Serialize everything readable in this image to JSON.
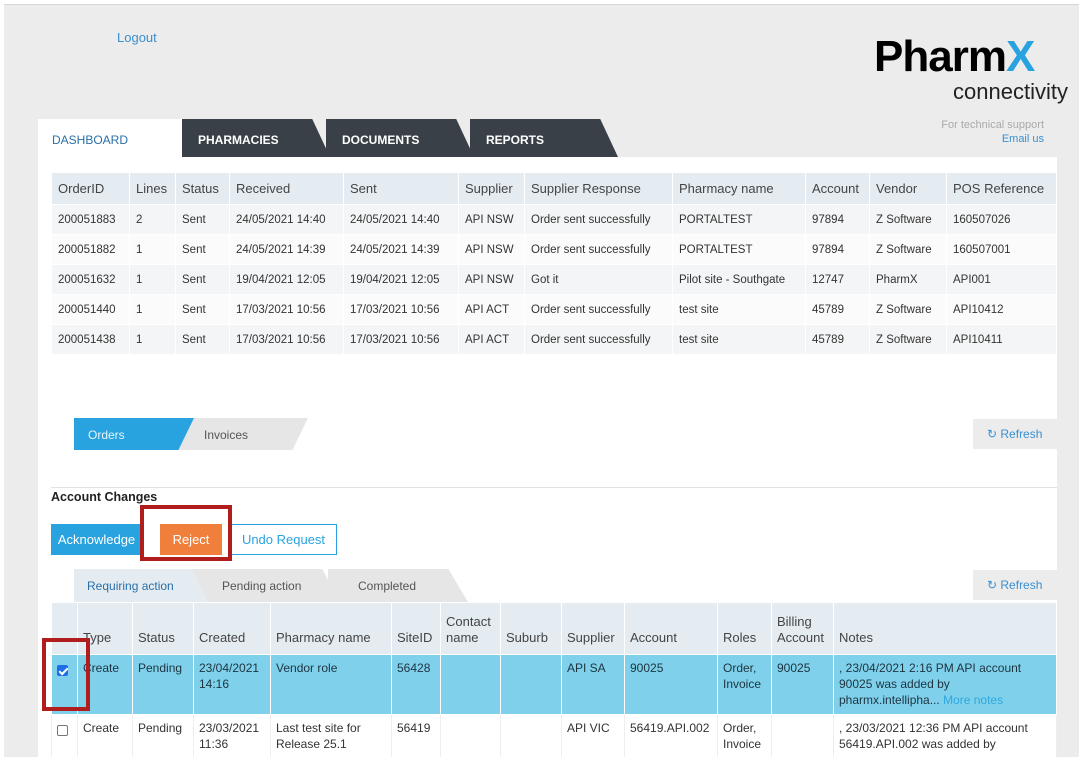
{
  "header": {
    "logout": "Logout",
    "logo_text_a": "Pharm",
    "logo_text_b": "X",
    "logo_sub": "connectivity",
    "support_text": "For technical support",
    "support_link": "Email us"
  },
  "nav": {
    "tabs": [
      "DASHBOARD",
      "PHARMACIES",
      "DOCUMENTS",
      "REPORTS"
    ]
  },
  "orders": {
    "columns": [
      "OrderID",
      "Lines",
      "Status",
      "Received",
      "Sent",
      "Supplier",
      "Supplier Response",
      "Pharmacy name",
      "Account",
      "Vendor",
      "POS Reference"
    ],
    "rows": [
      [
        "200051883",
        "2",
        "Sent",
        "24/05/2021 14:40",
        "24/05/2021 14:40",
        "API NSW",
        "Order sent successfully",
        "PORTALTEST",
        "97894",
        "Z Software",
        "160507026"
      ],
      [
        "200051882",
        "1",
        "Sent",
        "24/05/2021 14:39",
        "24/05/2021 14:39",
        "API NSW",
        "Order sent successfully",
        "PORTALTEST",
        "97894",
        "Z Software",
        "160507001"
      ],
      [
        "200051632",
        "1",
        "Sent",
        "19/04/2021 12:05",
        "19/04/2021 12:05",
        "API NSW",
        "Got it",
        "Pilot site - Southgate",
        "12747",
        "PharmX",
        "API001"
      ],
      [
        "200051440",
        "1",
        "Sent",
        "17/03/2021 10:56",
        "17/03/2021 10:56",
        "API ACT",
        "Order sent successfully",
        "test site",
        "45789",
        "Z Software",
        "API10412"
      ],
      [
        "200051438",
        "1",
        "Sent",
        "17/03/2021 10:56",
        "17/03/2021 10:56",
        "API ACT",
        "Order sent successfully",
        "test site",
        "45789",
        "Z Software",
        "API10411"
      ]
    ]
  },
  "subtabs": {
    "orders": "Orders",
    "invoices": "Invoices"
  },
  "refresh_label": "↻ Refresh",
  "account_changes": {
    "title": "Account Changes",
    "acknowledge": "Acknowledge",
    "reject": "Reject",
    "undo": "Undo Request",
    "tabs": [
      "Requiring action",
      "Pending action",
      "Completed"
    ],
    "columns": {
      "type": "Type",
      "status": "Status",
      "created": "Created",
      "pharmacy": "Pharmacy name",
      "siteid": "SiteID",
      "contact_a": "Contact",
      "contact_b": "name",
      "suburb": "Suburb",
      "supplier": "Supplier",
      "account": "Account",
      "roles": "Roles",
      "billing_a": "Billing",
      "billing_b": "Account",
      "notes": "Notes"
    },
    "rows": [
      {
        "checked": true,
        "type": "Create",
        "status": "Pending",
        "created": "23/04/2021 14:16",
        "pharmacy": "Vendor role",
        "siteid": "56428",
        "contact": "",
        "suburb": "",
        "supplier": "API SA",
        "account": "90025",
        "roles": "Order, Invoice",
        "billing": "90025",
        "notes": ", 23/04/2021 2:16 PM API account 90025 was added by pharmx.intellipha...",
        "more": "More notes"
      },
      {
        "checked": false,
        "type": "Create",
        "status": "Pending",
        "created": "23/03/2021 11:36",
        "pharmacy": "Last test site for Release 25.1",
        "siteid": "56419",
        "contact": "",
        "suburb": "",
        "supplier": "API VIC",
        "account": "56419.API.002",
        "roles": "Order, Invoice",
        "billing": "",
        "notes": ", 23/03/2021 12:36 PM API account 56419.API.002 was added by",
        "more": ""
      }
    ]
  }
}
